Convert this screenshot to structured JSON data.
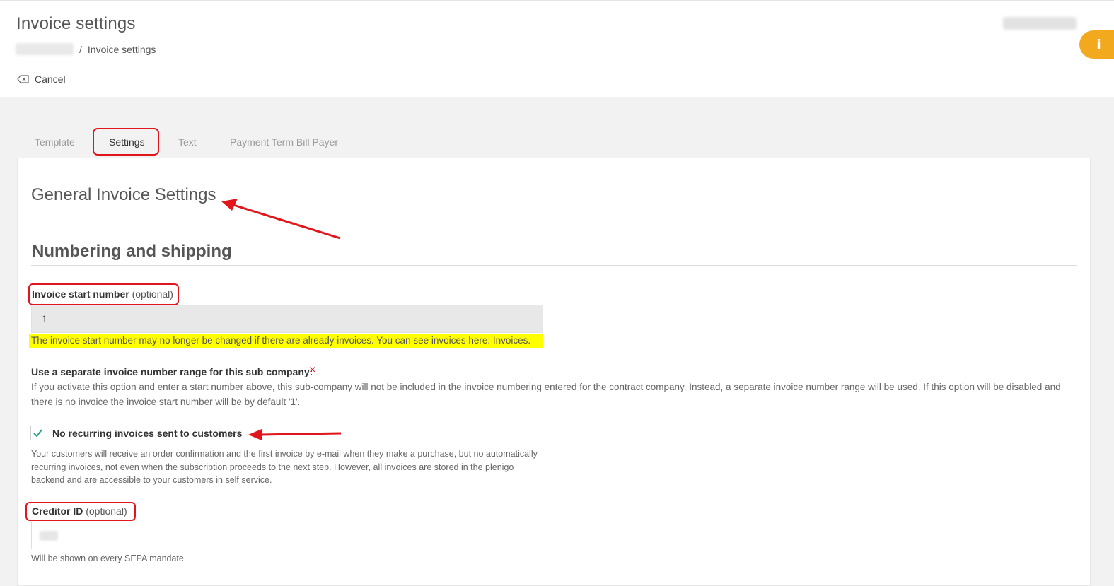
{
  "header": {
    "title": "Invoice settings",
    "breadcrumb": {
      "separator": "/",
      "current": "Invoice settings"
    }
  },
  "toolbar": {
    "cancel_label": "Cancel"
  },
  "tabs": [
    {
      "label": "Template",
      "active": false
    },
    {
      "label": "Settings",
      "active": true
    },
    {
      "label": "Text",
      "active": false
    },
    {
      "label": "Payment Term Bill Payer",
      "active": false
    }
  ],
  "info_button": {
    "label": "i",
    "color": "#f2a91d"
  },
  "content": {
    "general_title": "General Invoice Settings",
    "section_title": "Numbering and shipping",
    "invoice_start": {
      "label": "Invoice start number",
      "optional": "(optional)",
      "value": "1",
      "warning": "The invoice start number may no longer be changed if there are already invoices. You can see invoices here: Invoices."
    },
    "separate_range": {
      "label": "Use a separate invoice number range for this sub company:",
      "status_icon": "×",
      "description": "If you activate this option and enter a start number above, this sub-company will not be included in the invoice numbering entered for the contract company. Instead, a separate invoice number range will be used. If this option will be disabled and there is no invoice the invoice start number will be by default '1'."
    },
    "no_recurring": {
      "label": "No recurring invoices sent to customers",
      "checked": true,
      "description": "Your customers will receive an order confirmation and the first invoice by e-mail when they make a purchase, but no automatically recurring invoices, not even when the subscription proceeds to the next step. However, all invoices are stored in the plenigo backend and are accessible to your customers in self service."
    },
    "creditor": {
      "label": "Creditor ID",
      "optional": "(optional)",
      "help": "Will be shown on every SEPA mandate."
    }
  },
  "colors": {
    "accent": "#f2a91d",
    "highlight_border": "#e0161c",
    "warning_bg": "#ffff00",
    "check": "#2a9d8f"
  }
}
